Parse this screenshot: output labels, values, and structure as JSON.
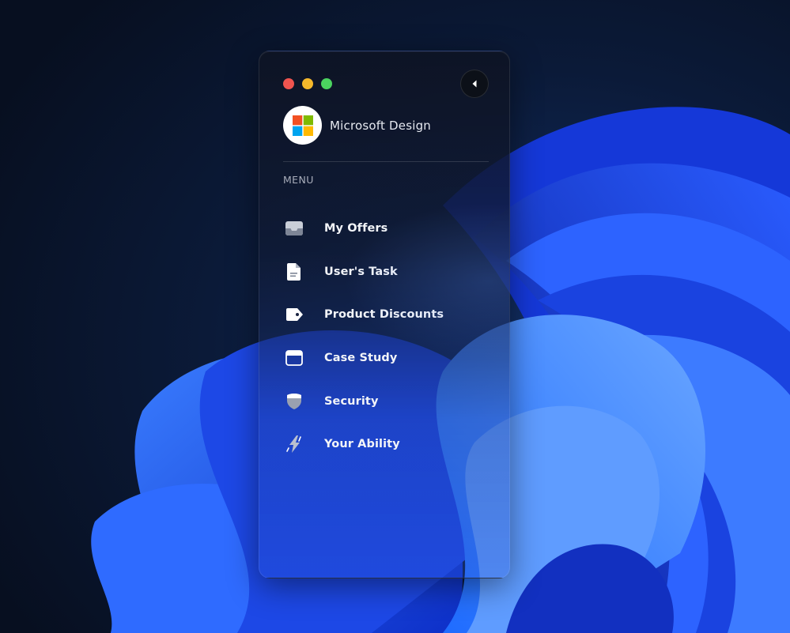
{
  "brand": {
    "name": "Microsoft Design",
    "logo_colors": [
      "#f25022",
      "#7fba00",
      "#00a4ef",
      "#ffb900"
    ]
  },
  "window_controls": {
    "close_color": "#f0544f",
    "minimize_color": "#f5b82b",
    "maximize_color": "#4bd35f"
  },
  "menu": {
    "heading": "MENU",
    "items": [
      {
        "label": "My Offers",
        "icon": "inbox-icon"
      },
      {
        "label": "User's Task",
        "icon": "document-icon"
      },
      {
        "label": "Product Discounts",
        "icon": "tag-icon"
      },
      {
        "label": "Case Study",
        "icon": "browser-window-icon"
      },
      {
        "label": "Security",
        "icon": "shield-icon"
      },
      {
        "label": "Your Ability",
        "icon": "lightning-icon"
      }
    ]
  }
}
